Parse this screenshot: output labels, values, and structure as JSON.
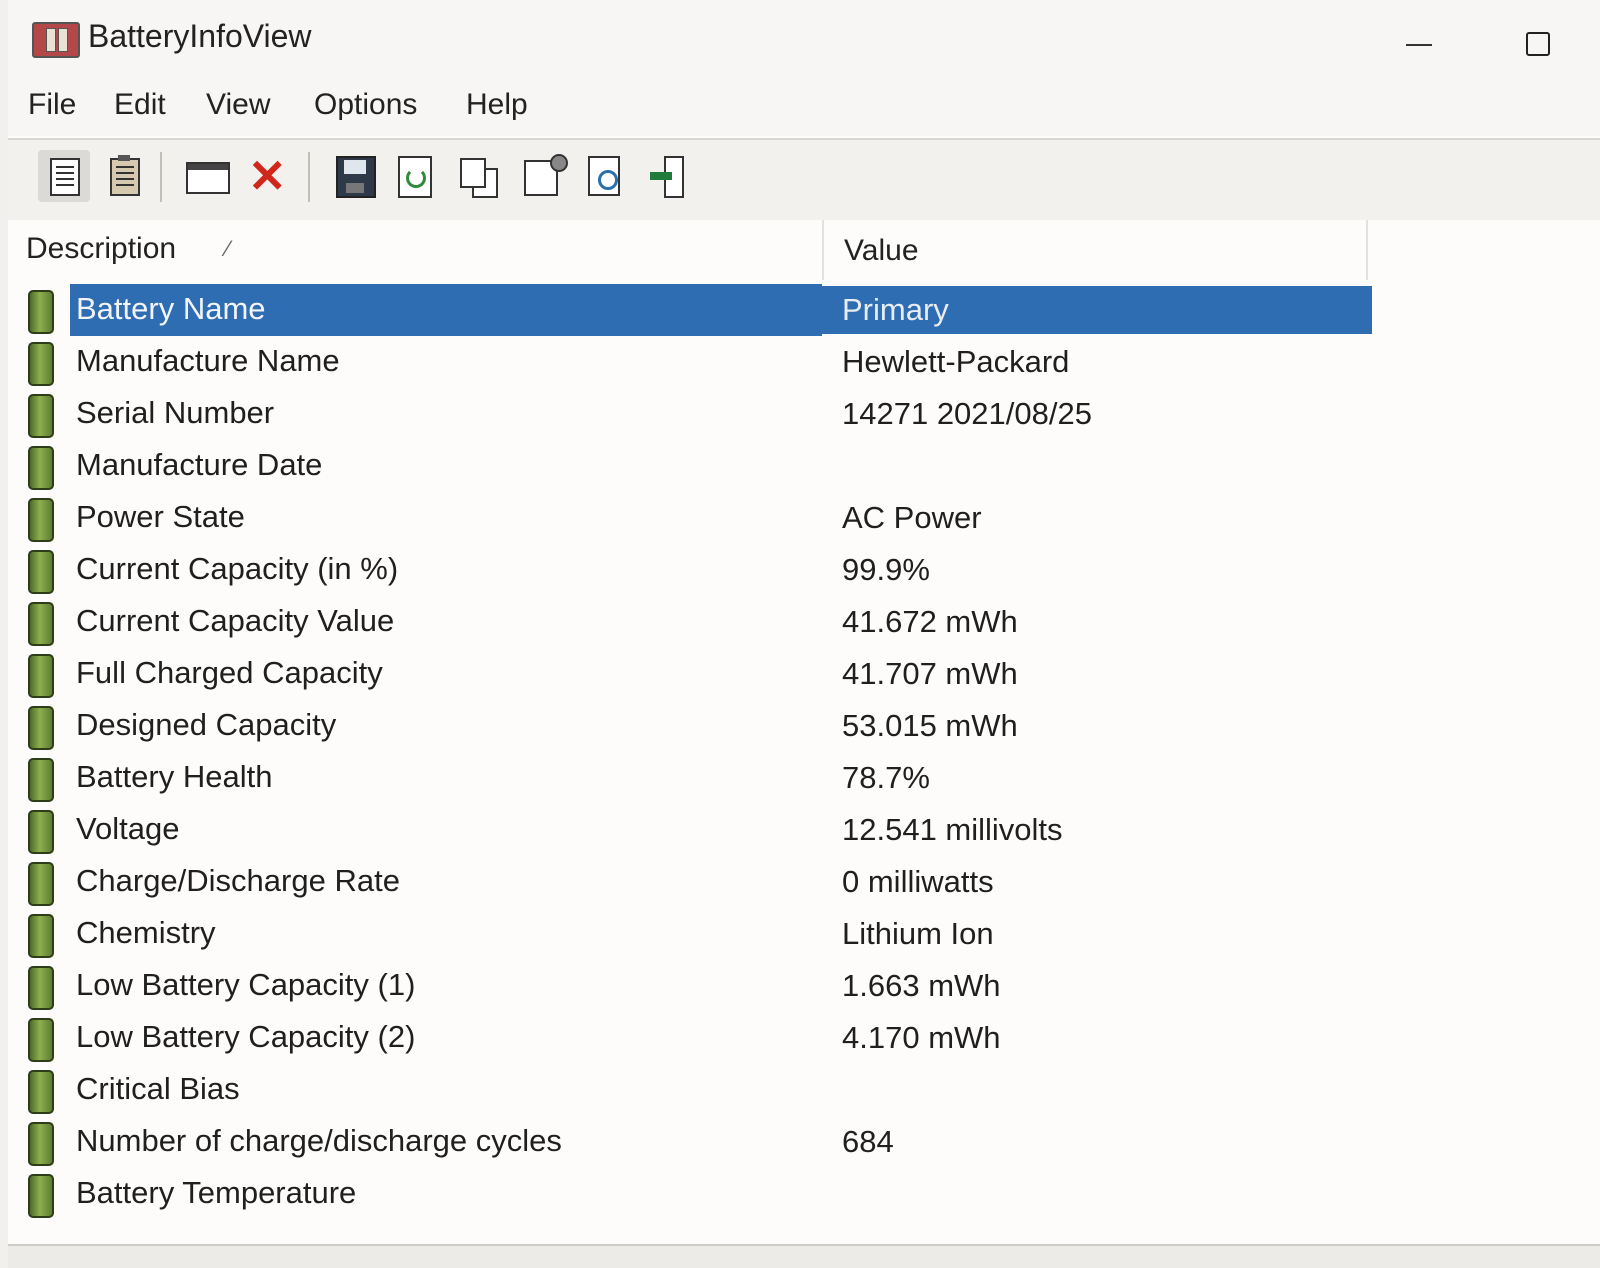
{
  "window": {
    "title": "BatteryInfoView"
  },
  "menu": [
    "File",
    "Edit",
    "View",
    "Options",
    "Help"
  ],
  "toolbar": {
    "buttons": [
      {
        "icon": "html-report-icon"
      },
      {
        "icon": "clipboard-icon"
      },
      {
        "icon": "window-icon"
      },
      {
        "icon": "delete-icon"
      },
      {
        "icon": "save-icon"
      },
      {
        "icon": "refresh-icon"
      },
      {
        "icon": "copy-icon"
      },
      {
        "icon": "properties-icon"
      },
      {
        "icon": "find-icon"
      },
      {
        "icon": "exit-icon"
      }
    ]
  },
  "list": {
    "columns": {
      "description": "Description",
      "value": "Value"
    },
    "rows": [
      {
        "description": "Battery Name",
        "value": "Primary",
        "selected": true
      },
      {
        "description": "Manufacture Name",
        "value": "Hewlett-Packard"
      },
      {
        "description": "Serial Number",
        "value": "14271 2021/08/25"
      },
      {
        "description": "Manufacture Date",
        "value": ""
      },
      {
        "description": "Power State",
        "value": "AC Power"
      },
      {
        "description": "Current Capacity (in %)",
        "value": "99.9%"
      },
      {
        "description": "Current Capacity Value",
        "value": "41.672 mWh"
      },
      {
        "description": "Full Charged Capacity",
        "value": "41.707 mWh"
      },
      {
        "description": "Designed Capacity",
        "value": "53.015 mWh"
      },
      {
        "description": "Battery Health",
        "value": "78.7%"
      },
      {
        "description": "Voltage",
        "value": "12.541 millivolts"
      },
      {
        "description": "Charge/Discharge Rate",
        "value": "0 milliwatts"
      },
      {
        "description": "Chemistry",
        "value": "Lithium Ion"
      },
      {
        "description": "Low Battery Capacity (1)",
        "value": "1.663 mWh"
      },
      {
        "description": "Low Battery Capacity (2)",
        "value": "4.170 mWh"
      },
      {
        "description": "Critical Bias",
        "value": ""
      },
      {
        "description": "Number of charge/discharge cycles",
        "value": "684"
      },
      {
        "description": "Battery Temperature",
        "value": ""
      }
    ]
  },
  "colors": {
    "selection": "#2f6db2",
    "battery_icon": "#6f8f3a",
    "delete_icon": "#d0261c"
  }
}
